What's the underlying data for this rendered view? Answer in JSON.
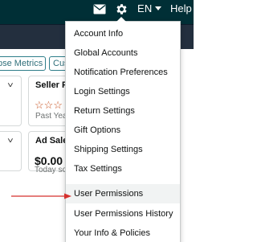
{
  "header": {
    "language": "EN",
    "help": "Help"
  },
  "toolbar": {
    "chips": [
      "pse Metrics",
      "Cus"
    ]
  },
  "cards": [
    {
      "title": "Seller Fe",
      "sub": "Past Year"
    },
    {
      "title": "Ad Sales",
      "value": "$0.00",
      "sub": "Today so"
    }
  ],
  "settings_menu": {
    "items": [
      "Account Info",
      "Global Accounts",
      "Notification Preferences",
      "Login Settings",
      "Return Settings",
      "Gift Options",
      "Shipping Settings",
      "Tax Settings",
      "User Permissions",
      "User Permissions History",
      "Your Info & Policies"
    ],
    "highlighted": "User Permissions"
  },
  "colors": {
    "topbar": "#002f36",
    "annotation_arrow": "#d5312e",
    "chip_border": "#2f7e8a"
  },
  "icons": [
    "mail-icon",
    "gear-icon",
    "chevron-down-icon",
    "star-icon",
    "arrow-annotation"
  ]
}
